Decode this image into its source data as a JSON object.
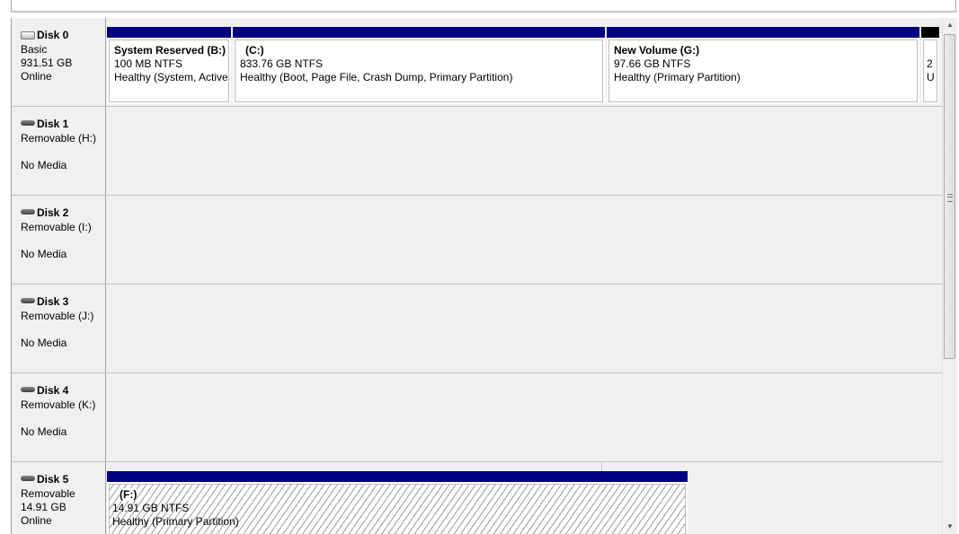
{
  "disks": [
    {
      "name": "Disk 0",
      "icon": "hard-disk-icon",
      "lines": [
        "Basic",
        "931.51 GB",
        "Online"
      ],
      "partitions": [
        {
          "title": "System Reserved  (B:)",
          "size": "100 MB NTFS",
          "status": "Healthy (System, Active"
        },
        {
          "title": "(C:)",
          "size": "833.76 GB NTFS",
          "status": "Healthy (Boot, Page File, Crash Dump, Primary Partition)"
        },
        {
          "title": "New Volume  (G:)",
          "size": "97.66 GB NTFS",
          "status": "Healthy (Primary Partition)"
        },
        {
          "title": "",
          "size": "2",
          "status": "U"
        }
      ]
    },
    {
      "name": "Disk 1",
      "icon": "removable-disk-icon",
      "lines": [
        "Removable (H:)",
        "",
        "No Media"
      ]
    },
    {
      "name": "Disk 2",
      "icon": "removable-disk-icon",
      "lines": [
        "Removable (I:)",
        "",
        "No Media"
      ]
    },
    {
      "name": "Disk 3",
      "icon": "removable-disk-icon",
      "lines": [
        "Removable (J:)",
        "",
        "No Media"
      ]
    },
    {
      "name": "Disk 4",
      "icon": "removable-disk-icon",
      "lines": [
        "Removable (K:)",
        "",
        "No Media"
      ]
    },
    {
      "name": "Disk 5",
      "icon": "removable-disk-icon",
      "lines": [
        "Removable",
        "14.91 GB",
        "Online"
      ],
      "partitions": [
        {
          "title": "(F:)",
          "size": "14.91 GB NTFS",
          "status": "Healthy (Primary Partition)"
        }
      ]
    }
  ],
  "colors": {
    "primary_bar": "#000080",
    "unallocated_bar": "#000000",
    "panel_bg": "#f0f0f0"
  },
  "scrollbar": {
    "up_icon": "arrow-up-icon",
    "down_icon": "arrow-down-icon"
  }
}
